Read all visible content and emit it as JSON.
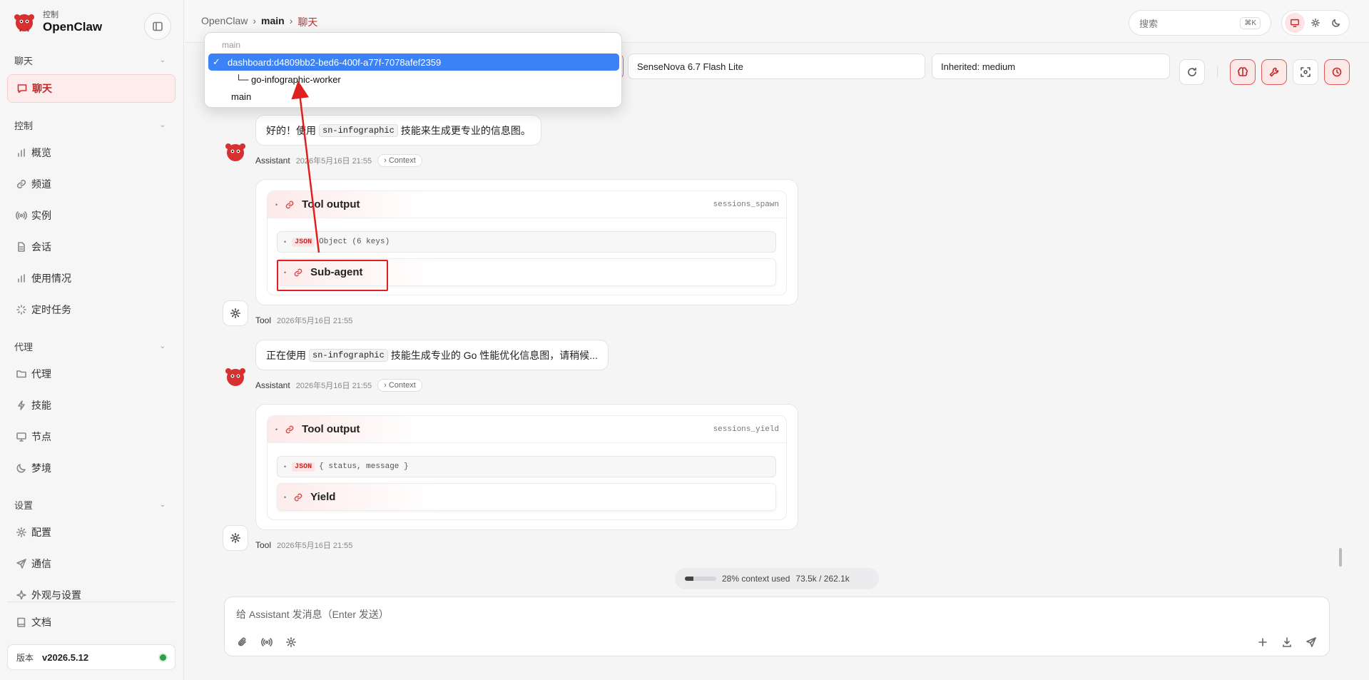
{
  "sidebar": {
    "brand_sub": "控制",
    "brand_name": "OpenClaw",
    "groups": {
      "chat": "聊天",
      "control": "控制",
      "agent": "代理",
      "settings": "设置"
    },
    "items": {
      "chat": "聊天",
      "overview": "概览",
      "channels": "频道",
      "instances": "实例",
      "sessions": "会话",
      "usage": "使用情况",
      "cron": "定时任务",
      "agents": "代理",
      "skills": "技能",
      "nodes": "节点",
      "dreams": "梦境",
      "config": "配置",
      "comms": "通信",
      "appearance": "外观与设置",
      "docs": "文档"
    },
    "version_label": "版本",
    "version_value": "v2026.5.12",
    "status_color": "#2e9e4a"
  },
  "topbar": {
    "breadcrumb": [
      "OpenClaw",
      "main",
      "聊天"
    ],
    "search_placeholder": "搜索",
    "search_shortcut": "⌘K",
    "theme_selected": "system"
  },
  "selects": {
    "model": "SenseNova 6.7 Flash Lite",
    "thinking": "Inherited: medium"
  },
  "session_dropdown": {
    "group_label": "main",
    "options": [
      "dashboard:d4809bb2-bed6-400f-a77f-7078afef2359",
      "└─ go-infographic-worker",
      "main"
    ],
    "selected_index": 0
  },
  "messages": {
    "m1": {
      "text_before": "好的！使用",
      "code": "sn-infographic",
      "text_after": "技能来生成更专业的信息图。",
      "role": "Assistant",
      "time": "2026年5月16日 21:55",
      "context": "Context"
    },
    "tool1": {
      "title": "Tool output",
      "tag": "sessions_spawn",
      "json_label": "JSON",
      "json_summary": "Object (6 keys)",
      "sub_title": "Sub-agent",
      "role": "Tool",
      "time": "2026年5月16日 21:55"
    },
    "m2": {
      "text_before": "正在使用",
      "code": "sn-infographic",
      "text_after": "技能生成专业的 Go 性能优化信息图，请稍候...",
      "role": "Assistant",
      "time": "2026年5月16日 21:55",
      "context": "Context"
    },
    "tool2": {
      "title": "Tool output",
      "tag": "sessions_yield",
      "json_label": "JSON",
      "json_summary": "{ status, message }",
      "sub_title": "Yield",
      "role": "Tool",
      "time": "2026年5月16日 21:55"
    }
  },
  "context_usage": {
    "label": "28% context used",
    "detail": "73.5k / 262.1k",
    "fraction": 0.28
  },
  "composer": {
    "placeholder": "给 Assistant 发消息（Enter 发送）"
  },
  "annotation_color": "#e02020",
  "accent_color": "#c62828",
  "selection_color": "#3b82f6"
}
